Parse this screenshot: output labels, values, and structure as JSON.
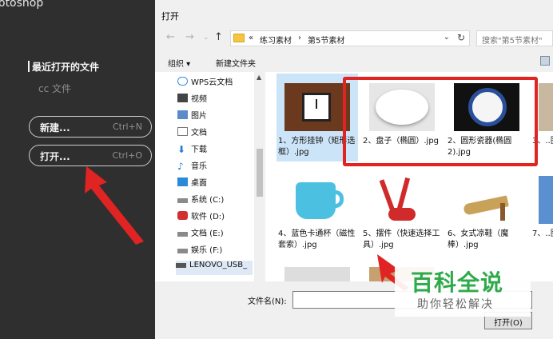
{
  "photoshop": {
    "title_fragment": "otoshop",
    "recent_label": "最近打开的文件",
    "cc_label": "cc 文件",
    "new_label": "新建...",
    "new_shortcut": "Ctrl+N",
    "open_label": "打开...",
    "open_shortcut": "Ctrl+O"
  },
  "dialog": {
    "title": "打开",
    "breadcrumb": [
      "«",
      "练习素材",
      "›",
      "第5节素材"
    ],
    "search_placeholder": "搜索\"第5节素材\"",
    "toolbar": {
      "organize": "组织 ▾",
      "new_folder": "新建文件夹"
    },
    "tree": [
      {
        "label": "WPS云文档",
        "icon": "cloud-icon"
      },
      {
        "label": "视频",
        "icon": "video-icon"
      },
      {
        "label": "图片",
        "icon": "image-icon"
      },
      {
        "label": "文档",
        "icon": "document-icon"
      },
      {
        "label": "下载",
        "icon": "download-icon"
      },
      {
        "label": "音乐",
        "icon": "music-icon"
      },
      {
        "label": "桌面",
        "icon": "desktop-icon"
      },
      {
        "label": "系统 (C:)",
        "icon": "drive-icon"
      },
      {
        "label": "软件 (D:)",
        "icon": "drive-icon"
      },
      {
        "label": "文档 (E:)",
        "icon": "drive-icon"
      },
      {
        "label": "娱乐 (F:)",
        "icon": "drive-icon"
      },
      {
        "label": "LENOVO_USB_",
        "icon": "usb-icon"
      }
    ],
    "files": [
      {
        "caption": "1、方形挂钟（矩形选框）.jpg"
      },
      {
        "caption": "2、盘子（椭圆）.jpg"
      },
      {
        "caption": "2、圆形瓷器(椭圆2).jpg"
      },
      {
        "caption": "3、..图.jpg"
      },
      {
        "caption": "4、蓝色卡通杯（磁性套索）.jpg"
      },
      {
        "caption": "5、摆件（快速选择工具）.jpg"
      },
      {
        "caption": "6、女式凉鞋（魔棒）.jpg"
      },
      {
        "caption": "7、..图2"
      }
    ],
    "filename_label": "文件名(N):",
    "open_button": "打开(O)"
  },
  "watermark": {
    "main": "百科全说",
    "sub": "助你轻松解决"
  },
  "colors": {
    "highlight": "#e02323",
    "arrow": "#e02323",
    "watermark_green": "#2faa4a"
  }
}
